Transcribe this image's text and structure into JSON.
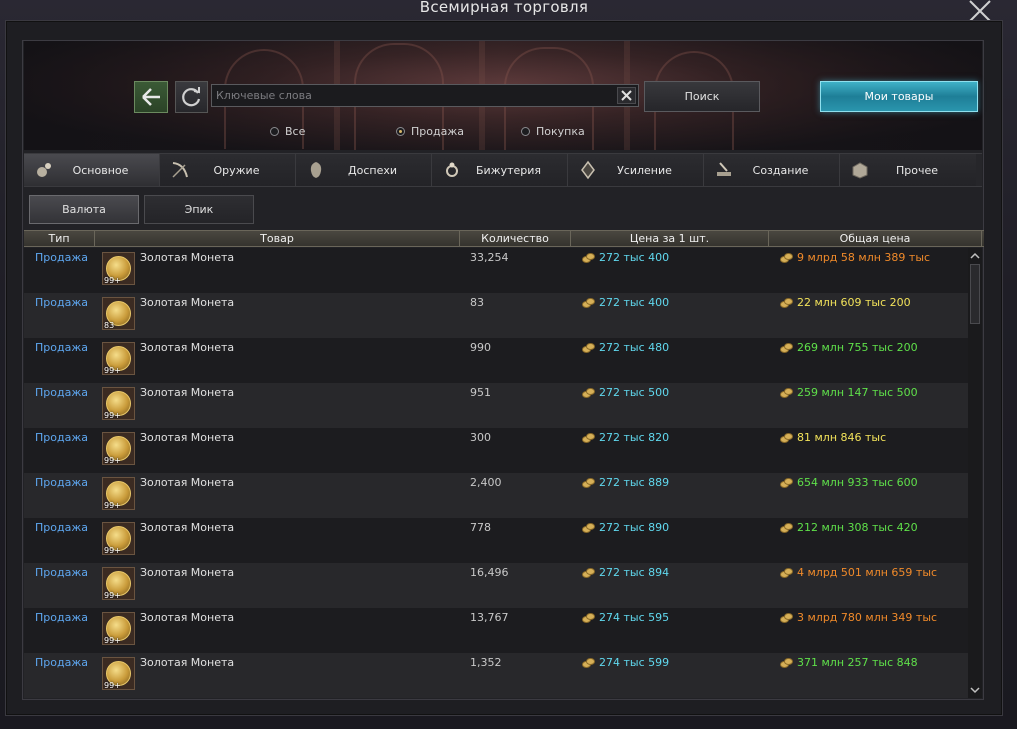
{
  "window": {
    "title": "Всемирная торговля"
  },
  "search": {
    "placeholder": "Ключевые слова",
    "value": "",
    "button_label": "Поиск"
  },
  "my_goods_label": "Мои товары",
  "filters": [
    {
      "label": "Все",
      "selected": false
    },
    {
      "label": "Продажа",
      "selected": true
    },
    {
      "label": "Покупка",
      "selected": false
    }
  ],
  "categories": [
    {
      "label": "Основное",
      "icon": "basic-icon",
      "active": true
    },
    {
      "label": "Оружие",
      "icon": "weapon-icon",
      "active": false
    },
    {
      "label": "Доспехи",
      "icon": "armor-icon",
      "active": false
    },
    {
      "label": "Бижутерия",
      "icon": "jewelry-icon",
      "active": false
    },
    {
      "label": "Усиление",
      "icon": "enhance-icon",
      "active": false
    },
    {
      "label": "Создание",
      "icon": "craft-icon",
      "active": false
    },
    {
      "label": "Прочее",
      "icon": "misc-icon",
      "active": false
    }
  ],
  "subcategories": [
    {
      "label": "Валюта",
      "active": true
    },
    {
      "label": "Эпик",
      "active": false
    }
  ],
  "table": {
    "headers": [
      "Тип",
      "Товар",
      "Количество",
      "Цена за 1 шт.",
      "Общая цена"
    ],
    "rows": [
      {
        "type": "Продажа",
        "item": "Золотая Монета",
        "stack": "99+",
        "qty": "33,254",
        "unit_price": "272 тыс 400",
        "total": "9 млрд 58 млн 389 тыс",
        "total_color": "#f08a2a"
      },
      {
        "type": "Продажа",
        "item": "Золотая Монета",
        "stack": "83",
        "qty": "83",
        "unit_price": "272 тыс 400",
        "total": "22 млн 609 тыс 200",
        "total_color": "#f2e25a"
      },
      {
        "type": "Продажа",
        "item": "Золотая Монета",
        "stack": "99+",
        "qty": "990",
        "unit_price": "272 тыс 480",
        "total": "269 млн 755 тыс 200",
        "total_color": "#5fe04a"
      },
      {
        "type": "Продажа",
        "item": "Золотая Монета",
        "stack": "99+",
        "qty": "951",
        "unit_price": "272 тыс 500",
        "total": "259 млн 147 тыс 500",
        "total_color": "#5fe04a"
      },
      {
        "type": "Продажа",
        "item": "Золотая Монета",
        "stack": "99+",
        "qty": "300",
        "unit_price": "272 тыс 820",
        "total": "81 млн 846 тыс",
        "total_color": "#f2e25a"
      },
      {
        "type": "Продажа",
        "item": "Золотая Монета",
        "stack": "99+",
        "qty": "2,400",
        "unit_price": "272 тыс 889",
        "total": "654 млн 933 тыс 600",
        "total_color": "#5fe04a"
      },
      {
        "type": "Продажа",
        "item": "Золотая Монета",
        "stack": "99+",
        "qty": "778",
        "unit_price": "272 тыс 890",
        "total": "212 млн 308 тыс 420",
        "total_color": "#5fe04a"
      },
      {
        "type": "Продажа",
        "item": "Золотая Монета",
        "stack": "99+",
        "qty": "16,496",
        "unit_price": "272 тыс 894",
        "total": "4 млрд 501 млн 659 тыс",
        "total_color": "#f08a2a"
      },
      {
        "type": "Продажа",
        "item": "Золотая Монета",
        "stack": "99+",
        "qty": "13,767",
        "unit_price": "274 тыс 595",
        "total": "3 млрд 780 млн 349 тыс",
        "total_color": "#f08a2a"
      },
      {
        "type": "Продажа",
        "item": "Золотая Монета",
        "stack": "99+",
        "qty": "1,352",
        "unit_price": "274 тыс 599",
        "total": "371 млн 257 тыс 848",
        "total_color": "#5fe04a"
      }
    ]
  },
  "colors": {
    "type_link": "#5ea7f0",
    "unit_price": "#60d8ee",
    "accent": "#3fb1c7"
  }
}
